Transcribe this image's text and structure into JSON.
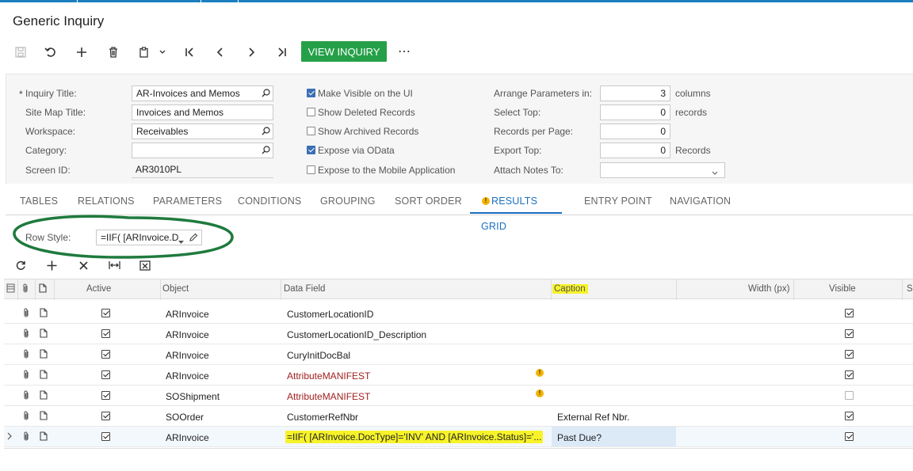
{
  "page": {
    "title": "Generic Inquiry"
  },
  "toolbar": {
    "view_inquiry_label": "VIEW INQUIRY",
    "more_label": "⋯"
  },
  "form": {
    "inquiry_title": {
      "label": "Inquiry Title:",
      "required_mark": "*",
      "value": "AR-Invoices and Memos"
    },
    "site_map_title": {
      "label": "Site Map Title:",
      "value": "Invoices and Memos"
    },
    "workspace": {
      "label": "Workspace:",
      "value": "Receivables"
    },
    "category": {
      "label": "Category:",
      "value": ""
    },
    "screen_id": {
      "label": "Screen ID:",
      "value": "AR3010PL"
    },
    "checks": [
      {
        "label": "Make Visible on the UI",
        "checked": true
      },
      {
        "label": "Show Deleted Records",
        "checked": false
      },
      {
        "label": "Show Archived Records",
        "checked": false
      },
      {
        "label": "Expose via OData",
        "checked": true
      },
      {
        "label": "Expose to the Mobile Application",
        "checked": false
      }
    ],
    "arrange_parameters": {
      "label": "Arrange Parameters in:",
      "value": "3",
      "suffix": "columns"
    },
    "select_top": {
      "label": "Select Top:",
      "value": "0",
      "suffix": "records"
    },
    "records_per_page": {
      "label": "Records per Page:",
      "value": "0"
    },
    "export_top": {
      "label": "Export Top:",
      "value": "0",
      "suffix": "Records"
    },
    "attach_notes_to": {
      "label": "Attach Notes To:",
      "value": ""
    }
  },
  "tabs": [
    {
      "label": "TABLES"
    },
    {
      "label": "RELATIONS"
    },
    {
      "label": "PARAMETERS"
    },
    {
      "label": "CONDITIONS"
    },
    {
      "label": "GROUPING"
    },
    {
      "label": "SORT ORDER"
    },
    {
      "label": "RESULTS GRID",
      "active": true,
      "warning": true
    },
    {
      "label": "ENTRY POINT"
    },
    {
      "label": "NAVIGATION"
    }
  ],
  "row_style": {
    "label": "Row Style:",
    "value": "=IIF( [ARInvoice.D"
  },
  "annotation_color": "#1f7a3e",
  "highlight_color": "#f7f32a",
  "grid": {
    "columns": [
      "Active",
      "Object",
      "Data Field",
      "Caption",
      "Width (px)",
      "Visible",
      "S"
    ],
    "rows": [
      {
        "active": true,
        "object": "ARInvoice",
        "data_field": "CustomerLocationID",
        "caption": "",
        "visible": true,
        "warning": false,
        "error": false
      },
      {
        "active": true,
        "object": "ARInvoice",
        "data_field": "CustomerLocationID_Description",
        "caption": "",
        "visible": true,
        "warning": false,
        "error": false
      },
      {
        "active": true,
        "object": "ARInvoice",
        "data_field": "CuryInitDocBal",
        "caption": "",
        "visible": true,
        "warning": false,
        "error": false
      },
      {
        "active": true,
        "object": "ARInvoice",
        "data_field": "AttributeMANIFEST",
        "caption": "",
        "visible": true,
        "warning": true,
        "error": true
      },
      {
        "active": true,
        "object": "SOShipment",
        "data_field": "AttributeMANIFEST",
        "caption": "",
        "visible": false,
        "warning": true,
        "error": true
      },
      {
        "active": true,
        "object": "SOOrder",
        "data_field": "CustomerRefNbr",
        "caption": "External Ref Nbr.",
        "visible": true,
        "warning": false,
        "error": false
      },
      {
        "active": true,
        "object": "ARInvoice",
        "data_field": "=IIF( [ARInvoice.DocType]='INV' AND [ARInvoice.Status]='...",
        "caption": "Past Due?",
        "visible": true,
        "warning": false,
        "error": false,
        "selected": true
      }
    ]
  }
}
